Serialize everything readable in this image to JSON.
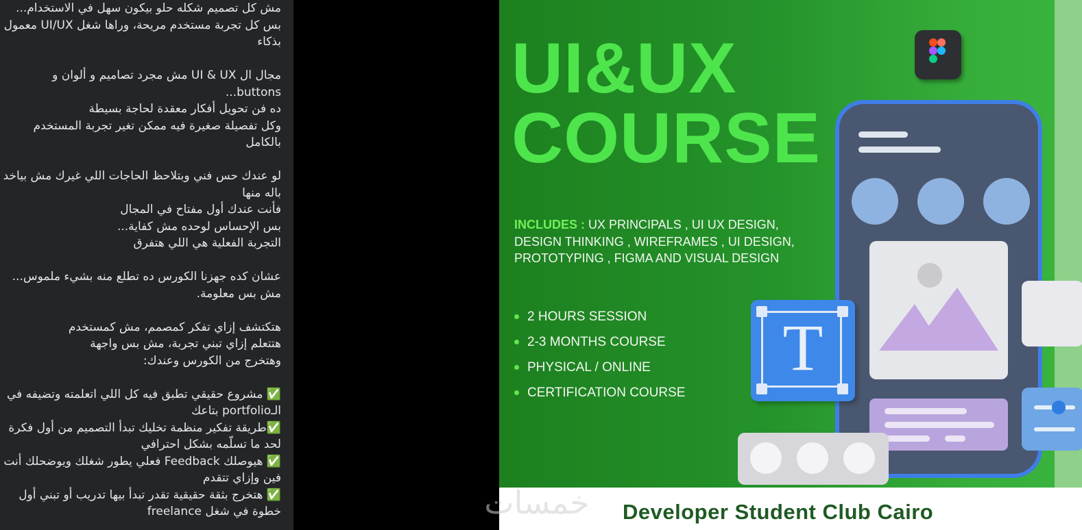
{
  "post": {
    "text": "مش كل تصميم شكله حلو بيكون سهل في الاستخدام...\nبس كل تجربة مستخدم مريحة، وراها شغل UI/UX معمول بذكاء\n\nمجال ال UI & UX مش مجرد تصاميم و ألوان و buttons...\nده فن تحويل أفكار معقدة لحاجة بسيطة\nوكل تفصيلة صغيرة فيه ممكن تغير تجربة المستخدم بالكامل\n\nلو عندك حس فني وبتلاحظ الحاجات اللي غيرك مش بياخد باله منها\nفأنت عندك أول مفتاح في المجال\nبس الإحساس لوحده مش كفاية...\nالتجربة الفعلية هي اللي هتفرق\n\nعشان كده جهزنا الكورس ده تطلع منه بشيء ملموس... مش بس معلومة.\n\nهتكتشف إزاي تفكر كمصمم، مش كمستخدم\nهتتعلم إزاي تبني تجربة، مش بس واجهة\nوهتخرج من الكورس وعندك:\n\n✅ مشروع حقيقي تطبق فيه كل اللي اتعلمته وتضيفه في الـportfolio بتاعك\n✅طريقة تفكير منظمة تخليك تبدأ التصميم من أول فكرة لحد ما تسلّمه بشكل احترافي\n✅ هيوصلك Feedback فعلي يطور شغلك ويوضحلك أنت فين وإزاي تتقدم\n✅ هتخرج بثقة حقيقية تقدر تبدأ بيها تدريب أو تبني أول خطوة في شغل freelance"
  },
  "poster": {
    "title_line1": "UI&UX",
    "title_line2": "COURSE",
    "includes_label": "INCLUDES :",
    "includes_text": " UX PRINCIPALS , UI UX DESIGN, DESIGN THINKING , WIREFRAMES , UI DESIGN, PROTOTYPING , FIGMA AND VISUAL DESIGN",
    "features": [
      "2 HOURS SESSION",
      "2-3 MONTHS COURSE",
      "PHYSICAL / ONLINE",
      "CERTIFICATION COURSE"
    ],
    "text_tool_glyph": "T",
    "footer_text": "Developer Student Club Cairo"
  },
  "watermark": {
    "text": "خمسات"
  },
  "colors": {
    "title_green": "#4ee54c",
    "poster_green": "#24922a",
    "phone_border": "#3f7ee6",
    "footer_text": "#1f5a24"
  }
}
